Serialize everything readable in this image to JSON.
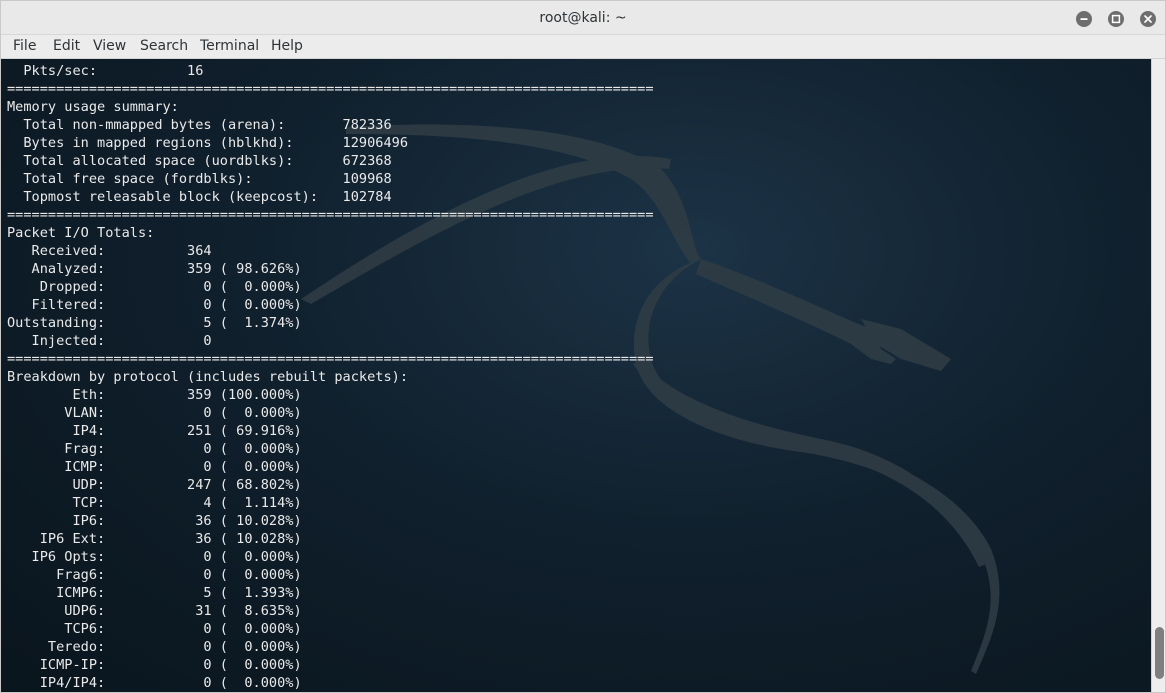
{
  "window": {
    "title": "root@kali: ~"
  },
  "menubar": {
    "items": [
      "File",
      "Edit",
      "View",
      "Search",
      "Terminal",
      "Help"
    ]
  },
  "terminal": {
    "lines": [
      "  Pkts/sec:           16",
      "===============================================================================",
      "Memory usage summary:",
      "  Total non-mmapped bytes (arena):       782336",
      "  Bytes in mapped regions (hblkhd):      12906496",
      "  Total allocated space (uordblks):      672368",
      "  Total free space (fordblks):           109968",
      "  Topmost releasable block (keepcost):   102784",
      "===============================================================================",
      "Packet I/O Totals:",
      "   Received:          364",
      "   Analyzed:          359 ( 98.626%)",
      "    Dropped:            0 (  0.000%)",
      "   Filtered:            0 (  0.000%)",
      "Outstanding:            5 (  1.374%)",
      "   Injected:            0",
      "===============================================================================",
      "Breakdown by protocol (includes rebuilt packets):",
      "        Eth:          359 (100.000%)",
      "       VLAN:            0 (  0.000%)",
      "        IP4:          251 ( 69.916%)",
      "       Frag:            0 (  0.000%)",
      "       ICMP:            0 (  0.000%)",
      "        UDP:          247 ( 68.802%)",
      "        TCP:            4 (  1.114%)",
      "        IP6:           36 ( 10.028%)",
      "    IP6 Ext:           36 ( 10.028%)",
      "   IP6 Opts:            0 (  0.000%)",
      "      Frag6:            0 (  0.000%)",
      "      ICMP6:            5 (  1.393%)",
      "       UDP6:           31 (  8.635%)",
      "       TCP6:            0 (  0.000%)",
      "     Teredo:            0 (  0.000%)",
      "    ICMP-IP:            0 (  0.000%)",
      "    IP4/IP4:            0 (  0.000%)"
    ]
  },
  "icons": {
    "minimize": "minimize-icon",
    "maximize": "maximize-icon",
    "close": "close-icon",
    "background": "kali-dragon-logo"
  },
  "colors": {
    "titlebar": "#e9e9e9",
    "terminal_bg": "#0f1c27",
    "terminal_text": "#eaeaea"
  }
}
